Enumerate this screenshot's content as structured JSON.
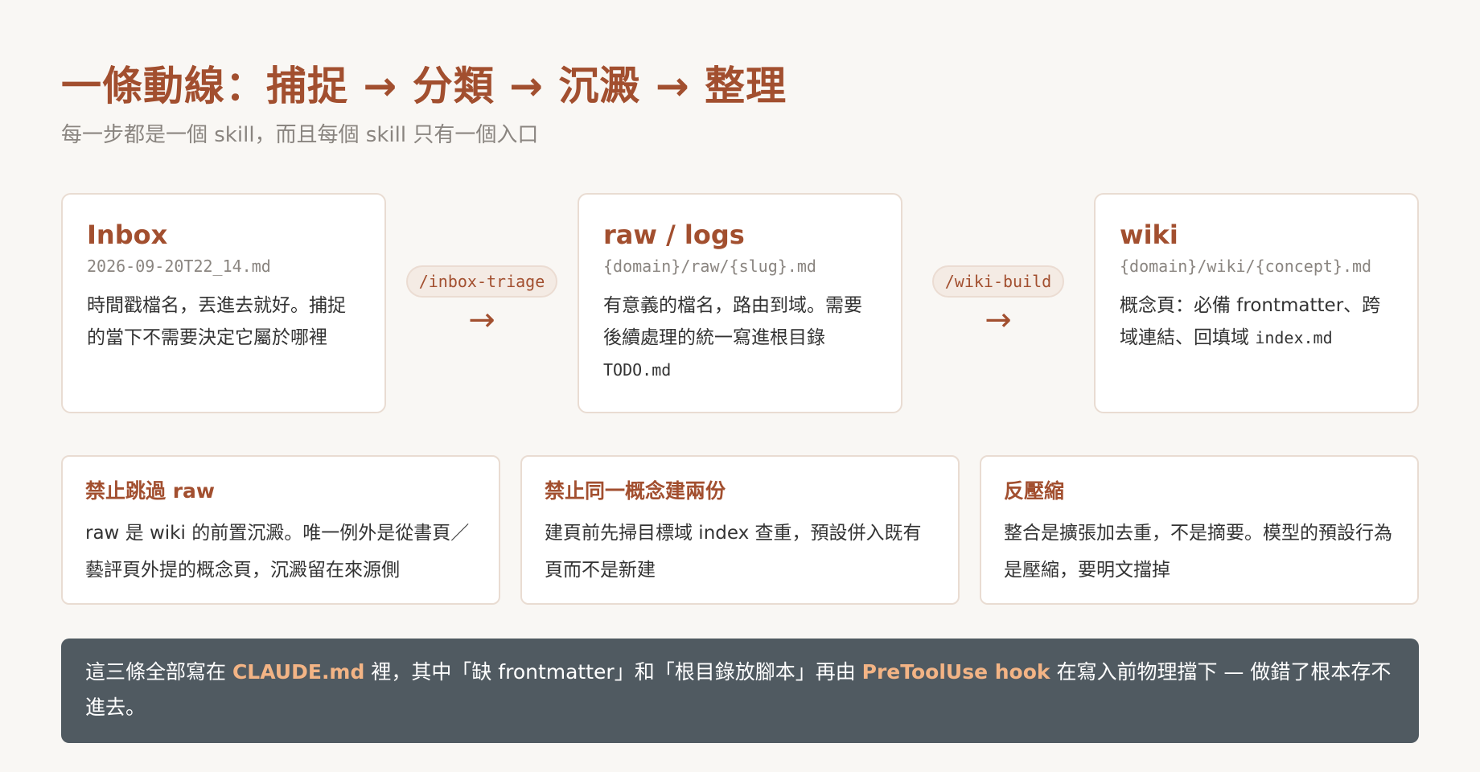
{
  "header": {
    "title": "一條動線：捕捉 → 分類 → 沉澱 → 整理",
    "subtitle": "每一步都是一個 skill，而且每個 skill 只有一個入口"
  },
  "stages": [
    {
      "title": "Inbox",
      "path": "2026-09-20T22_14.md",
      "desc": "時間戳檔名，丟進去就好。捕捉的當下不需要決定它屬於哪裡",
      "desc_code": ""
    },
    {
      "title": "raw / logs",
      "path": "{domain}/raw/{slug}.md",
      "desc": "有意義的檔名，路由到域。需要後續處理的統一寫進根目錄",
      "desc_code": "TODO.md"
    },
    {
      "title": "wiki",
      "path": "{domain}/wiki/{concept}.md",
      "desc": "概念頁：必備 frontmatter、跨域連結、回填域 ",
      "desc_code": "index.md"
    }
  ],
  "connectors": [
    {
      "command": "/inbox-triage",
      "arrow": "→"
    },
    {
      "command": "/wiki-build",
      "arrow": "→"
    }
  ],
  "rules": [
    {
      "title": "禁止跳過 raw",
      "body": "raw 是 wiki 的前置沉澱。唯一例外是從書頁／藝評頁外提的概念頁，沉澱留在來源側"
    },
    {
      "title": "禁止同一概念建兩份",
      "body": "建頁前先掃目標域 index 查重，預設併入既有頁而不是新建"
    },
    {
      "title": "反壓縮",
      "body": "整合是擴張加去重，不是摘要。模型的預設行為是壓縮，要明文擋掉"
    }
  ],
  "banner": {
    "part1": "這三條全部寫在 ",
    "highlight1": "CLAUDE.md",
    "part2": " 裡，其中「缺 frontmatter」和「根目錄放腳本」再由 ",
    "highlight2": "PreToolUse hook",
    "part3": " 在寫入前物理擋下 — 做錯了根本存不進去。"
  },
  "colors": {
    "accent": "#a24f2f",
    "muted": "#8a8580",
    "background": "#f9f7f4",
    "banner_bg": "#505a61",
    "banner_highlight": "#f3b485"
  }
}
